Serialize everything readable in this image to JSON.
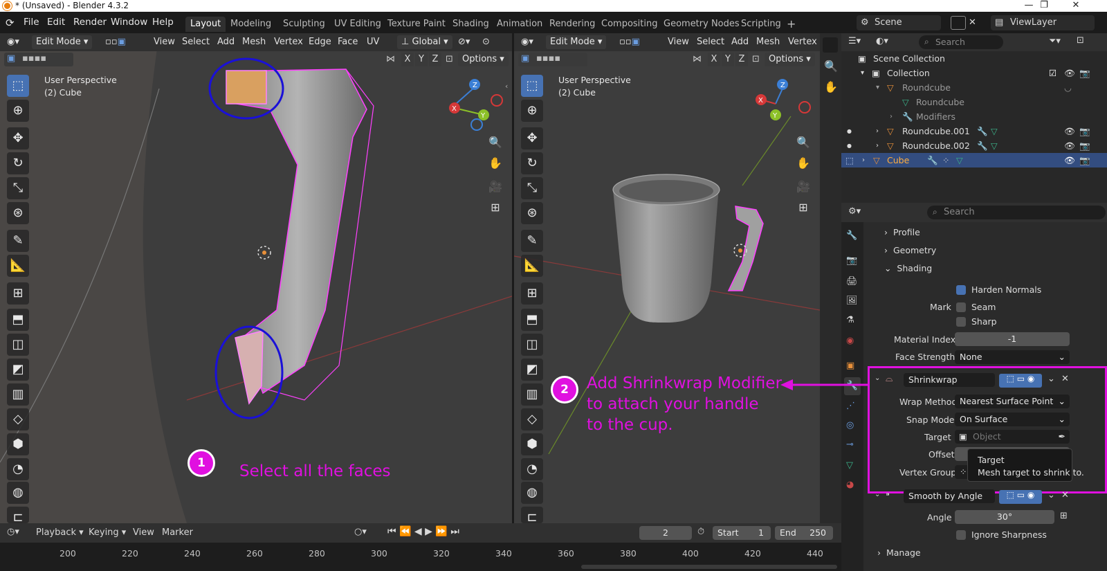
{
  "window": {
    "title": "* (Unsaved) - Blender 4.3.2"
  },
  "menus": [
    "File",
    "Edit",
    "Render",
    "Window",
    "Help"
  ],
  "workspace_tabs": [
    "Layout",
    "Modeling",
    "Sculpting",
    "UV Editing",
    "Texture Paint",
    "Shading",
    "Animation",
    "Rendering",
    "Compositing",
    "Geometry Nodes",
    "Scripting"
  ],
  "active_workspace": "Layout",
  "scene": {
    "name": "Scene",
    "view_layer": "ViewLayer"
  },
  "viewport_left": {
    "mode": "Edit Mode",
    "menus": [
      "View",
      "Select",
      "Add",
      "Mesh",
      "Vertex",
      "Edge",
      "Face",
      "UV"
    ],
    "orientation": "Global",
    "axes": [
      "X",
      "Y",
      "Z"
    ],
    "options": "Options",
    "info_line1": "User Perspective",
    "info_line2": "(2) Cube"
  },
  "viewport_right": {
    "mode": "Edit Mode",
    "menus": [
      "View",
      "Select",
      "Add",
      "Mesh",
      "Vertex"
    ],
    "axes": [
      "X",
      "Y",
      "Z"
    ],
    "options": "Options",
    "info_line1": "User Perspective",
    "info_line2": "(2) Cube"
  },
  "outliner": {
    "search_placeholder": "Search",
    "rows": [
      {
        "label": "Scene Collection"
      },
      {
        "label": "Collection"
      },
      {
        "label": "Roundcube"
      },
      {
        "label": "Roundcube"
      },
      {
        "label": "Modifiers"
      },
      {
        "label": "Roundcube.001"
      },
      {
        "label": "Roundcube.002"
      },
      {
        "label": "Cube"
      }
    ]
  },
  "properties": {
    "search_placeholder": "Search",
    "panels": {
      "profile": "Profile",
      "geometry": "Geometry",
      "shading": "Shading",
      "manage": "Manage"
    },
    "harden_normals": "Harden Normals",
    "mark_label": "Mark",
    "seam": "Seam",
    "sharp": "Sharp",
    "material_index_label": "Material Index",
    "material_index_value": "-1",
    "face_strength_label": "Face Strength",
    "face_strength_value": "None",
    "shrinkwrap": {
      "name": "Shrinkwrap",
      "wrap_method_label": "Wrap Method",
      "wrap_method_value": "Nearest Surface Point",
      "snap_mode_label": "Snap Mode",
      "snap_mode_value": "On Surface",
      "target_label": "Target",
      "target_placeholder": "Object",
      "offset_label": "Offset",
      "vertex_group_label": "Vertex Group"
    },
    "tooltip": {
      "title": "Target",
      "text": "Mesh target to shrink to."
    },
    "smooth": {
      "name": "Smooth by Angle",
      "angle_label": "Angle",
      "angle_value": "30°",
      "ignore_sharpness": "Ignore Sharpness"
    }
  },
  "timeline": {
    "menus": [
      "Playback",
      "Keying",
      "View",
      "Marker"
    ],
    "current_frame": "2",
    "start_label": "Start",
    "start_value": "1",
    "end_label": "End",
    "end_value": "250",
    "ticks": [
      "200",
      "220",
      "240",
      "260",
      "280",
      "300",
      "320",
      "340",
      "360",
      "380",
      "400",
      "420",
      "440"
    ]
  },
  "annotations": {
    "step1_num": "1",
    "step1_text": "Select all the faces",
    "step2_num": "2",
    "step2_line1": "Add Shrinkwrap Modifier",
    "step2_line2": "to attach your handle",
    "step2_line3": "to the cup."
  },
  "colors": {
    "accent": "#e010e0",
    "selection_blue": "#4772b3",
    "annotation_circle": "#1a10d8"
  }
}
